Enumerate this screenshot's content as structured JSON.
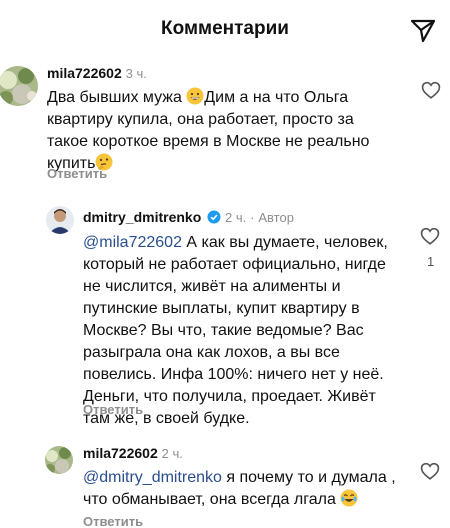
{
  "header": {
    "title": "Комментарии",
    "share_icon": "paper-plane-icon"
  },
  "comments": [
    {
      "username": "mila722602",
      "time": "3 ч.",
      "text_before_emoji": "Два бывших мужа ",
      "emoji1": "grinning-face-emoji",
      "text_after_emoji": "Дим  а на что Ольга квартиру купила, она работает, просто за такое короткое время в Москве не реально купить",
      "emoji2": "thinking-face-emoji",
      "reply_label": "Ответить"
    },
    {
      "username": "dmitry_dmitrenko",
      "verified": true,
      "time": "2 ч.",
      "author_tag": "Автор",
      "mention": "@mila722602",
      "text": " А как вы думаете, человек, который не работает официально, нигде не числится, живёт на алименты и путинские выплаты, купит квартиру в Москве? Вы что, такие ведомые? Вас разыграла она как лохов, а вы все повелись. Инфа 100%: ничего нет у неё. Деньги, что получила, проедает. Живёт там же, в своей будке.",
      "likes": "1",
      "reply_label": "Ответить"
    },
    {
      "username": "mila722602",
      "time": "2 ч.",
      "mention": "@dmitry_dmitrenko",
      "text": " я почему то и думала , что обманывает, она всегда лгала ",
      "emoji": "tears-of-joy-emoji",
      "reply_label": "Ответить"
    }
  ],
  "colors": {
    "mention": "#2a4e8f",
    "meta": "#8e8e8e",
    "verified": "#1d9bf0"
  }
}
